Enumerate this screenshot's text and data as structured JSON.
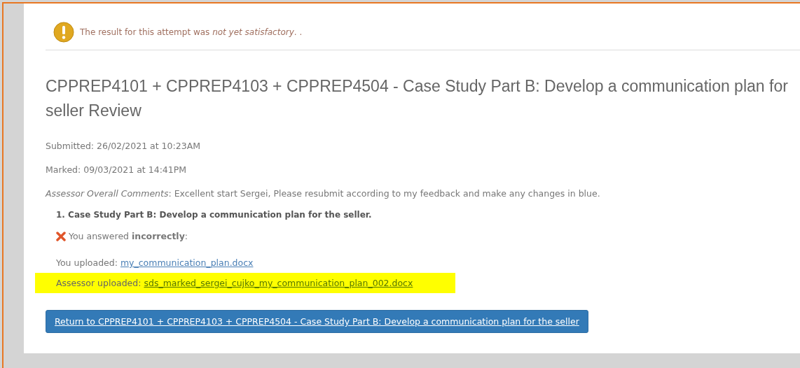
{
  "alert": {
    "text": "The result for this attempt was *not yet satisfactory*. ."
  },
  "title_lines": [
    "CPPREP4101 + CPPREP4103 + CPPREP4504 - Case Study Part B: Develop a communication plan for",
    "seller Review"
  ],
  "submitted": "Submitted: 26/02/2021 at 10:23AM",
  "marked": "Marked: 09/03/2021 at 14:41PM",
  "comments": "*Assessor Overall Comments*: Excellent start Sergei, Please resubmit according to my feedback and make any changes in blue.",
  "question": {
    "heading": "1. Case Study Part B: Develop a communication plan for the seller.",
    "result": "You answered **incorrectly**:",
    "uploads": [
      {
        "label": "You uploaded:",
        "file": "my_communication_plan.docx",
        "highlighted": false
      },
      {
        "label": "Assessor uploaded:",
        "file": "sds_marked_sergei_cujko_my_communication_plan_002.docx",
        "highlighted": true
      }
    ]
  },
  "return_button": "Return to CPPREP4101 + CPPREP4103 + CPPREP4504 - Case Study Part B: Develop a communication plan for the seller"
}
